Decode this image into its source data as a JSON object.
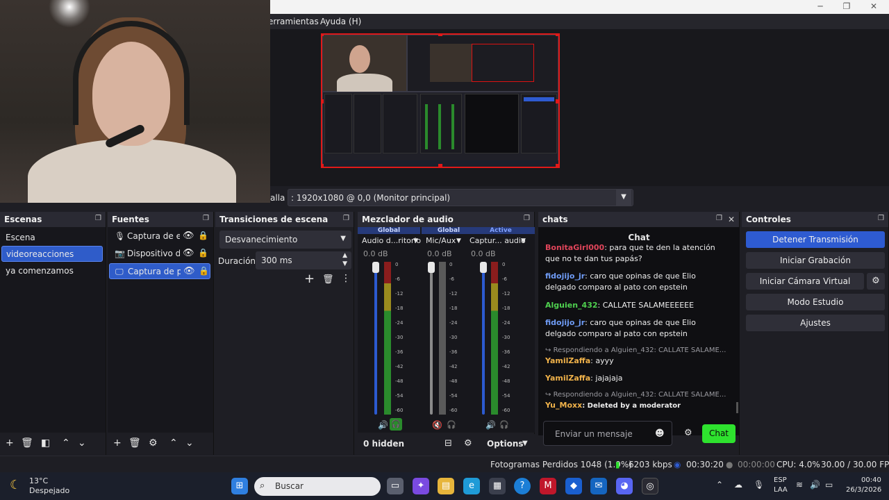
{
  "menu": {
    "tools": "erramientas",
    "help": "Ayuda (H)"
  },
  "source_bar": {
    "label": "alla",
    "monitor": ": 1920x1080 @ 0,0 (Monitor principal)"
  },
  "scenes": {
    "title": "Escenas",
    "items": [
      "Escena",
      "videoreacciones",
      "ya comenzamos"
    ],
    "selected": 1
  },
  "sources": {
    "title": "Fuentes",
    "items": [
      {
        "label": "Captura de ent",
        "icon": "microphone-icon"
      },
      {
        "label": "Dispositivo de",
        "icon": "camera-icon"
      },
      {
        "label": "Captura de par",
        "icon": "monitor-icon"
      }
    ],
    "selected": 2
  },
  "transitions": {
    "title": "Transiciones de escena",
    "selected": "Desvanecimiento",
    "duration_label": "Duración",
    "duration_value": "300 ms"
  },
  "mixer": {
    "title": "Mezclador de audio",
    "channels": [
      {
        "tag": "Global",
        "name": "Audio d...ritorio",
        "db": "0.0 dB",
        "level": 0.45
      },
      {
        "tag": "Global",
        "name": "Mic/Aux",
        "db": "0.0 dB",
        "level": 0.0
      },
      {
        "tag": "Active",
        "name": "Captur... audio",
        "db": "0.0 dB",
        "level": 0.0
      }
    ],
    "ticks": [
      "0",
      "-6",
      "-12",
      "-18",
      "-24",
      "-30",
      "-36",
      "-42",
      "-48",
      "-54",
      "-60"
    ],
    "hidden": "0 hidden",
    "options": "Options"
  },
  "chats": {
    "title": "chats",
    "panel_title": "Chat",
    "messages": [
      {
        "user": "BonitaGirl000",
        "user_color": "#e0455a",
        "text": ": para que te den la atención que no te dan tus papás?"
      },
      {
        "user": "fidojijo_jr",
        "user_color": "#6f9cf6",
        "text": ": caro que opinas de que Elio delgado comparo al pato con epstein"
      },
      {
        "user": "Alguien_432",
        "user_color": "#4fd14f",
        "text": ": CALLATE SALAMEEEEEE"
      },
      {
        "user": "fidojijo_jr",
        "user_color": "#6f9cf6",
        "text": ": caro que opinas de que Elio delgado comparo al pato con epstein"
      },
      {
        "reply": "Respondiendo a Alguien_432: CALLATE SALAME...",
        "user": "YamilZaffa",
        "user_color": "#f0b24a",
        "text": ": ayyy"
      },
      {
        "user": "YamilZaffa",
        "user_color": "#f0b24a",
        "text": ": jajajaja"
      },
      {
        "reply": "Respondiendo a Alguien_432: CALLATE SALAME...",
        "user": "Yu_Moxx",
        "user_color": "#f0b24a",
        "text": ": Deleted by a moderator"
      }
    ],
    "input_placeholder": "Enviar un mensaje",
    "send_label": "Chat"
  },
  "controls": {
    "title": "Controles",
    "buttons": [
      "Detener Transmisión",
      "Iniciar Grabación",
      "Iniciar Cámara Virtual",
      "Modo Estudio",
      "Ajustes"
    ]
  },
  "status": {
    "dropped": "Fotogramas Perdidos 1048 (1.9%)",
    "bitrate": "6203 kbps",
    "stream_time": "00:30:20",
    "rec_time": "00:00:00",
    "cpu": "CPU: 4.0%",
    "fps": "30.00 / 30.00 FPS"
  },
  "taskbar": {
    "weather_temp": "13°C",
    "weather_desc": "Despejado",
    "search_placeholder": "Buscar",
    "lang1": "ESP",
    "lang2": "LAA",
    "time": "00:40",
    "date": "26/3/2026"
  }
}
